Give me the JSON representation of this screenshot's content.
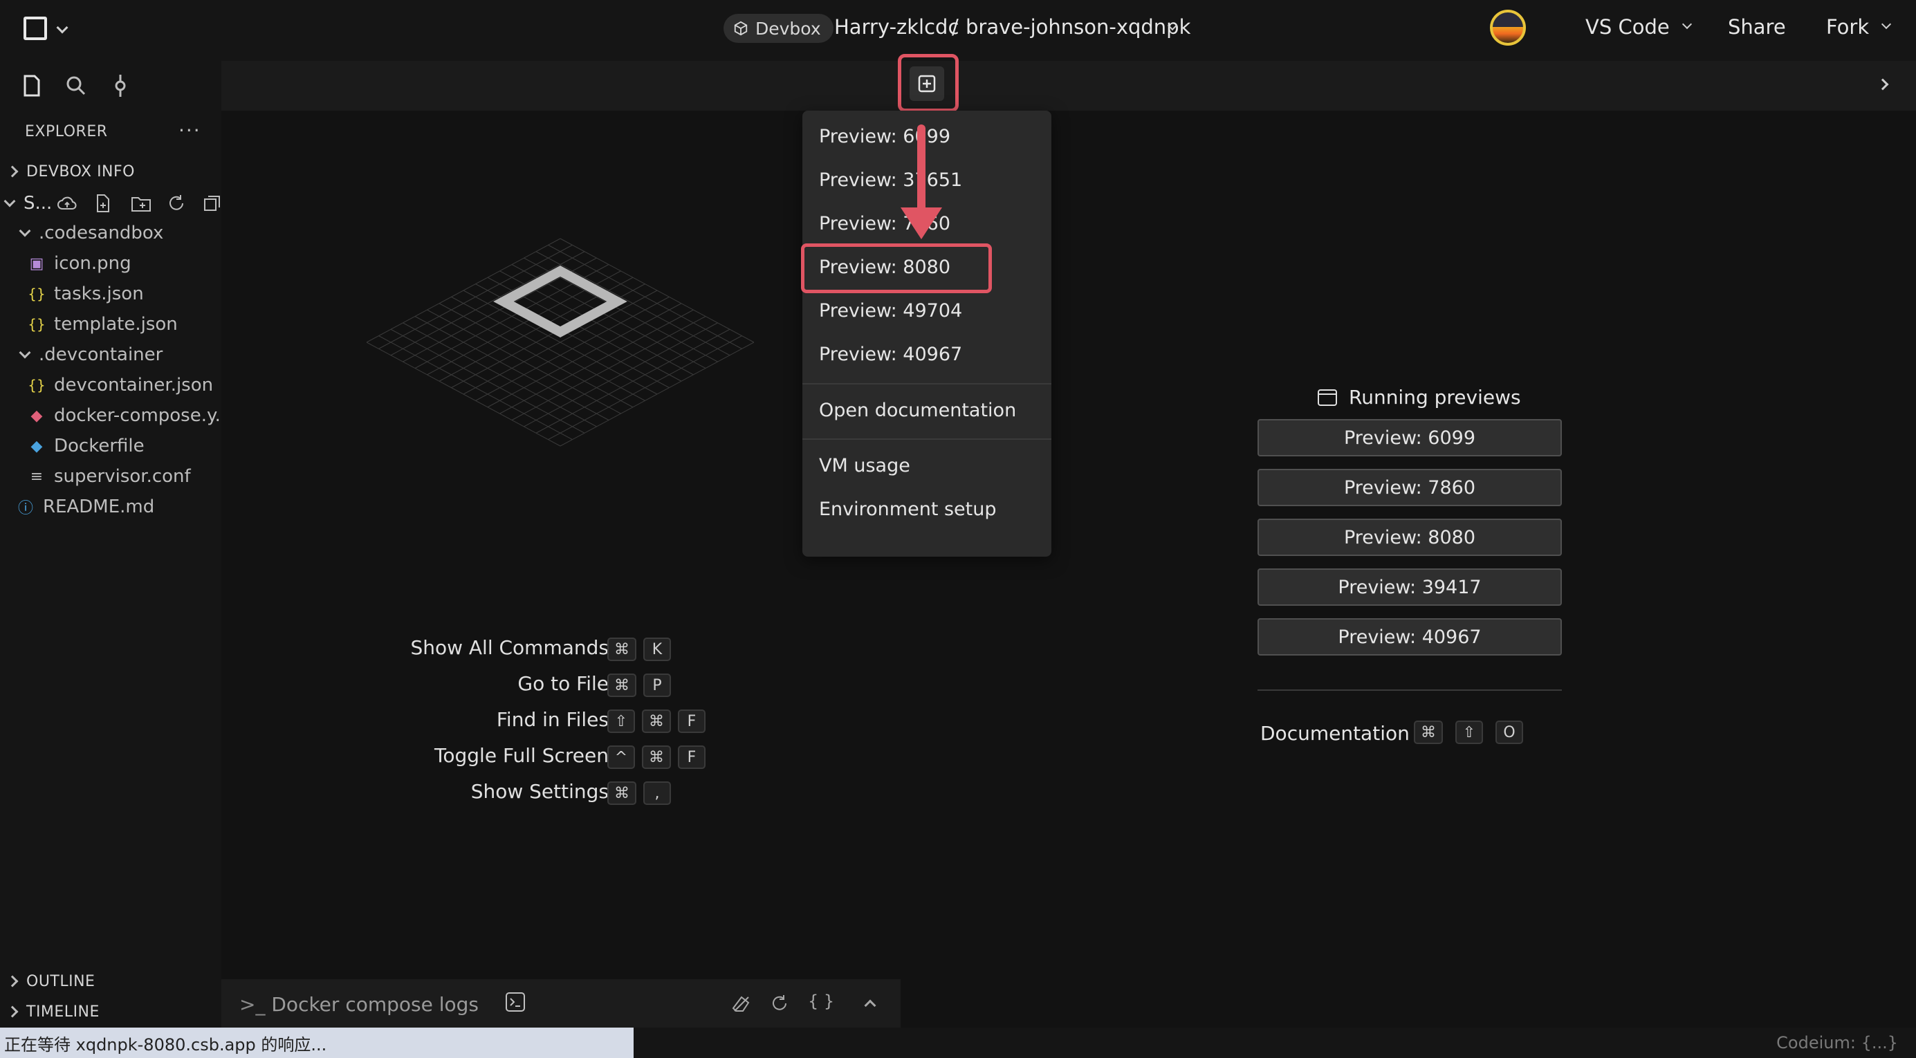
{
  "topbar": {
    "devbox_label": "Devbox",
    "owner": "Harry-zklcdc",
    "separator": "/",
    "project": "brave-johnson-xqdnpk",
    "editor_label": "VS Code",
    "share_label": "Share",
    "fork_label": "Fork"
  },
  "sidebar": {
    "explorer_title": "EXPLORER",
    "more_label": "···",
    "devbox_info": "DEVBOX INFO",
    "root_label": "S...",
    "tree": [
      {
        "label": ".codesandbox",
        "icon": "folder-open"
      },
      {
        "label": "icon.png",
        "icon": "image-icon"
      },
      {
        "label": "tasks.json",
        "icon": "json-icon"
      },
      {
        "label": "template.json",
        "icon": "json-icon"
      },
      {
        "label": ".devcontainer",
        "icon": "folder-open"
      },
      {
        "label": "devcontainer.json",
        "icon": "json-icon"
      },
      {
        "label": "docker-compose.y...",
        "icon": "docker-icon"
      },
      {
        "label": "Dockerfile",
        "icon": "docker-icon"
      },
      {
        "label": "supervisor.conf",
        "icon": "text-file-icon"
      },
      {
        "label": "README.md",
        "icon": "info-icon"
      }
    ],
    "outline": "OUTLINE",
    "timeline": "TIMELINE"
  },
  "menu": {
    "items": [
      "Preview: 6099",
      "Preview: 37651",
      "Preview: 7860",
      "Preview: 8080",
      "Preview: 49704",
      "Preview: 40967"
    ],
    "open_docs": "Open documentation",
    "vm_usage": "VM usage",
    "env_setup": "Environment setup"
  },
  "shortcuts": [
    {
      "label": "Show All Commands",
      "keys": [
        "⌘",
        "K"
      ]
    },
    {
      "label": "Go to File",
      "keys": [
        "⌘",
        "P"
      ]
    },
    {
      "label": "Find in Files",
      "keys": [
        "⇧",
        "⌘",
        "F"
      ]
    },
    {
      "label": "Toggle Full Screen",
      "keys": [
        "^",
        "⌘",
        "F"
      ]
    },
    {
      "label": "Show Settings",
      "keys": [
        "⌘",
        ","
      ]
    }
  ],
  "running_previews": {
    "title": "Running previews",
    "buttons": [
      "Preview: 6099",
      "Preview: 7860",
      "Preview: 8080",
      "Preview: 39417",
      "Preview: 40967"
    ],
    "documentation_label": "Documentation",
    "documentation_keys": [
      "⌘",
      "⇧",
      "O"
    ]
  },
  "terminal": {
    "title": "Docker compose logs"
  },
  "status": {
    "message": "正在等待 xqdnpk-8080.csb.app 的响应...",
    "right": "Codeium: {...}"
  },
  "colors": {
    "highlight": "#e05563",
    "background": "#121212"
  }
}
